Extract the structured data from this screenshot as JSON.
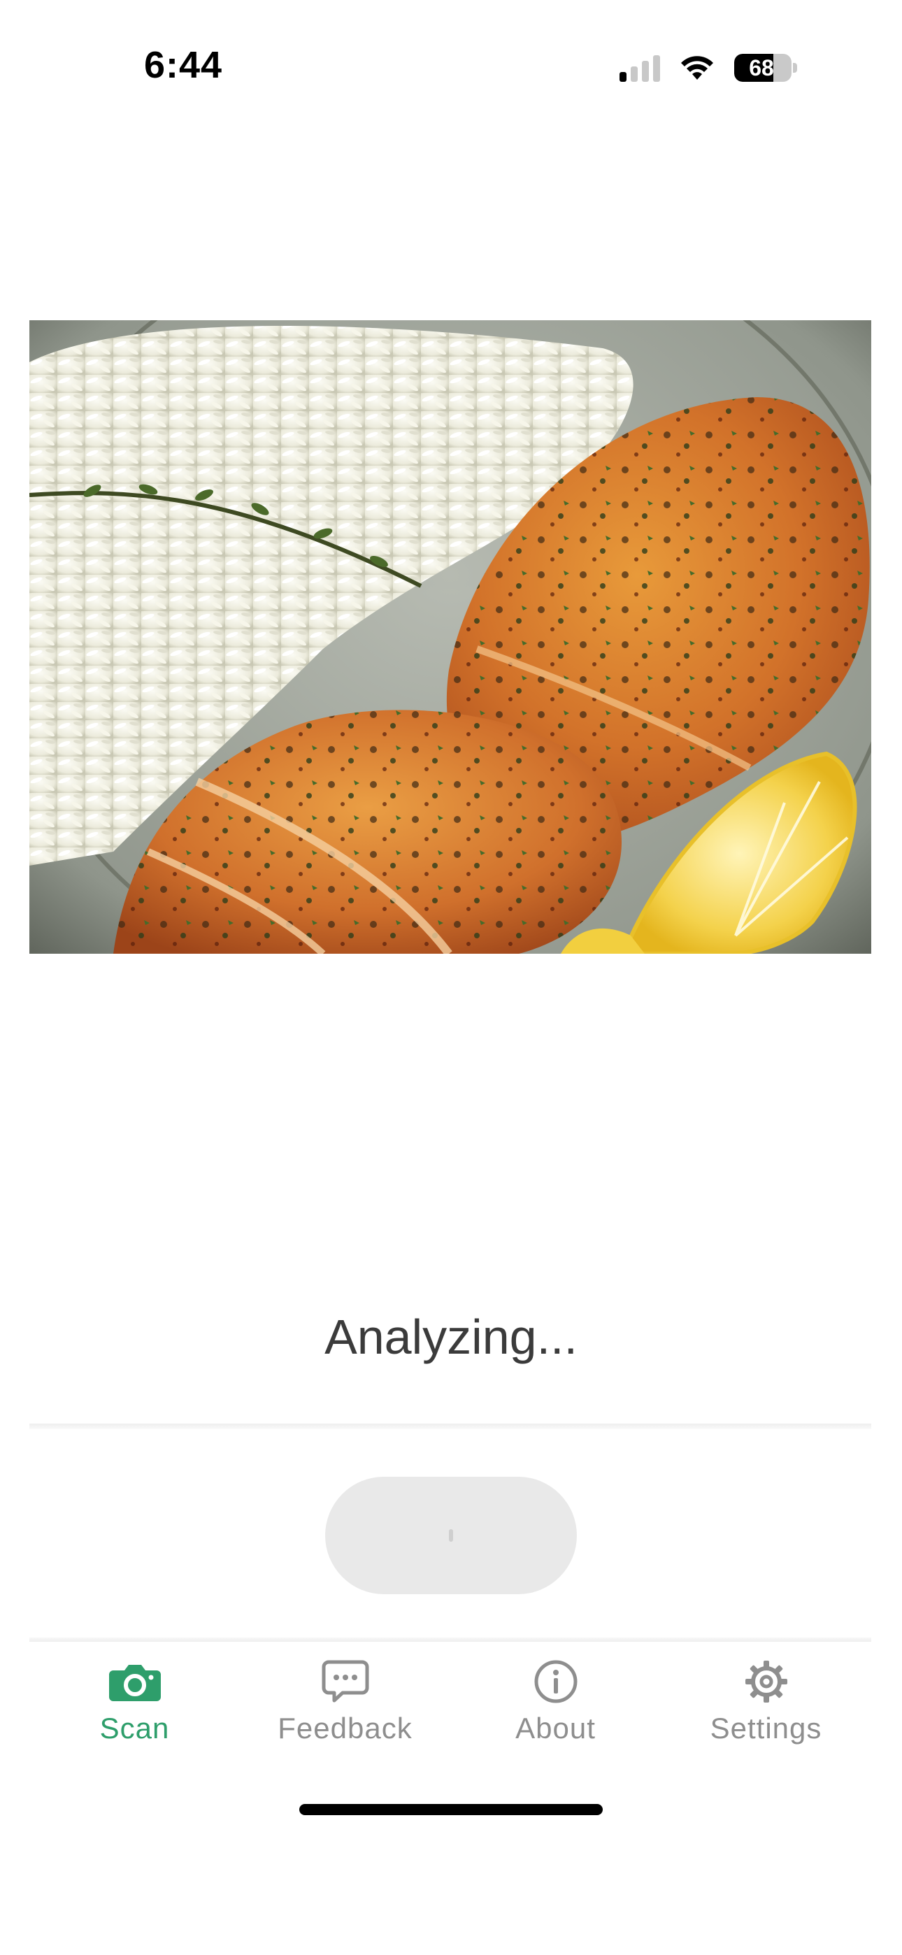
{
  "status_bar": {
    "time": "6:44",
    "battery_level": "68",
    "battery_fraction": 0.68,
    "signal_bars_active": 1,
    "signal_bars_total": 4,
    "icons": [
      "cellular-signal-icon",
      "wifi-icon",
      "battery-icon"
    ]
  },
  "photo": {
    "subject": "grilled-chicken-rice-plate-image"
  },
  "status": {
    "text": "Analyzing..."
  },
  "action": {
    "state": "disabled-loading"
  },
  "tabs": [
    {
      "label": "Scan",
      "icon": "camera-icon",
      "active": true
    },
    {
      "label": "Feedback",
      "icon": "chat-bubble-icon",
      "active": false
    },
    {
      "label": "About",
      "icon": "info-icon",
      "active": false
    },
    {
      "label": "Settings",
      "icon": "gear-icon",
      "active": false
    }
  ],
  "colors": {
    "accent": "#2e9e6b",
    "inactive": "#8e8e8e",
    "button_disabled": "#e9e9e9"
  }
}
